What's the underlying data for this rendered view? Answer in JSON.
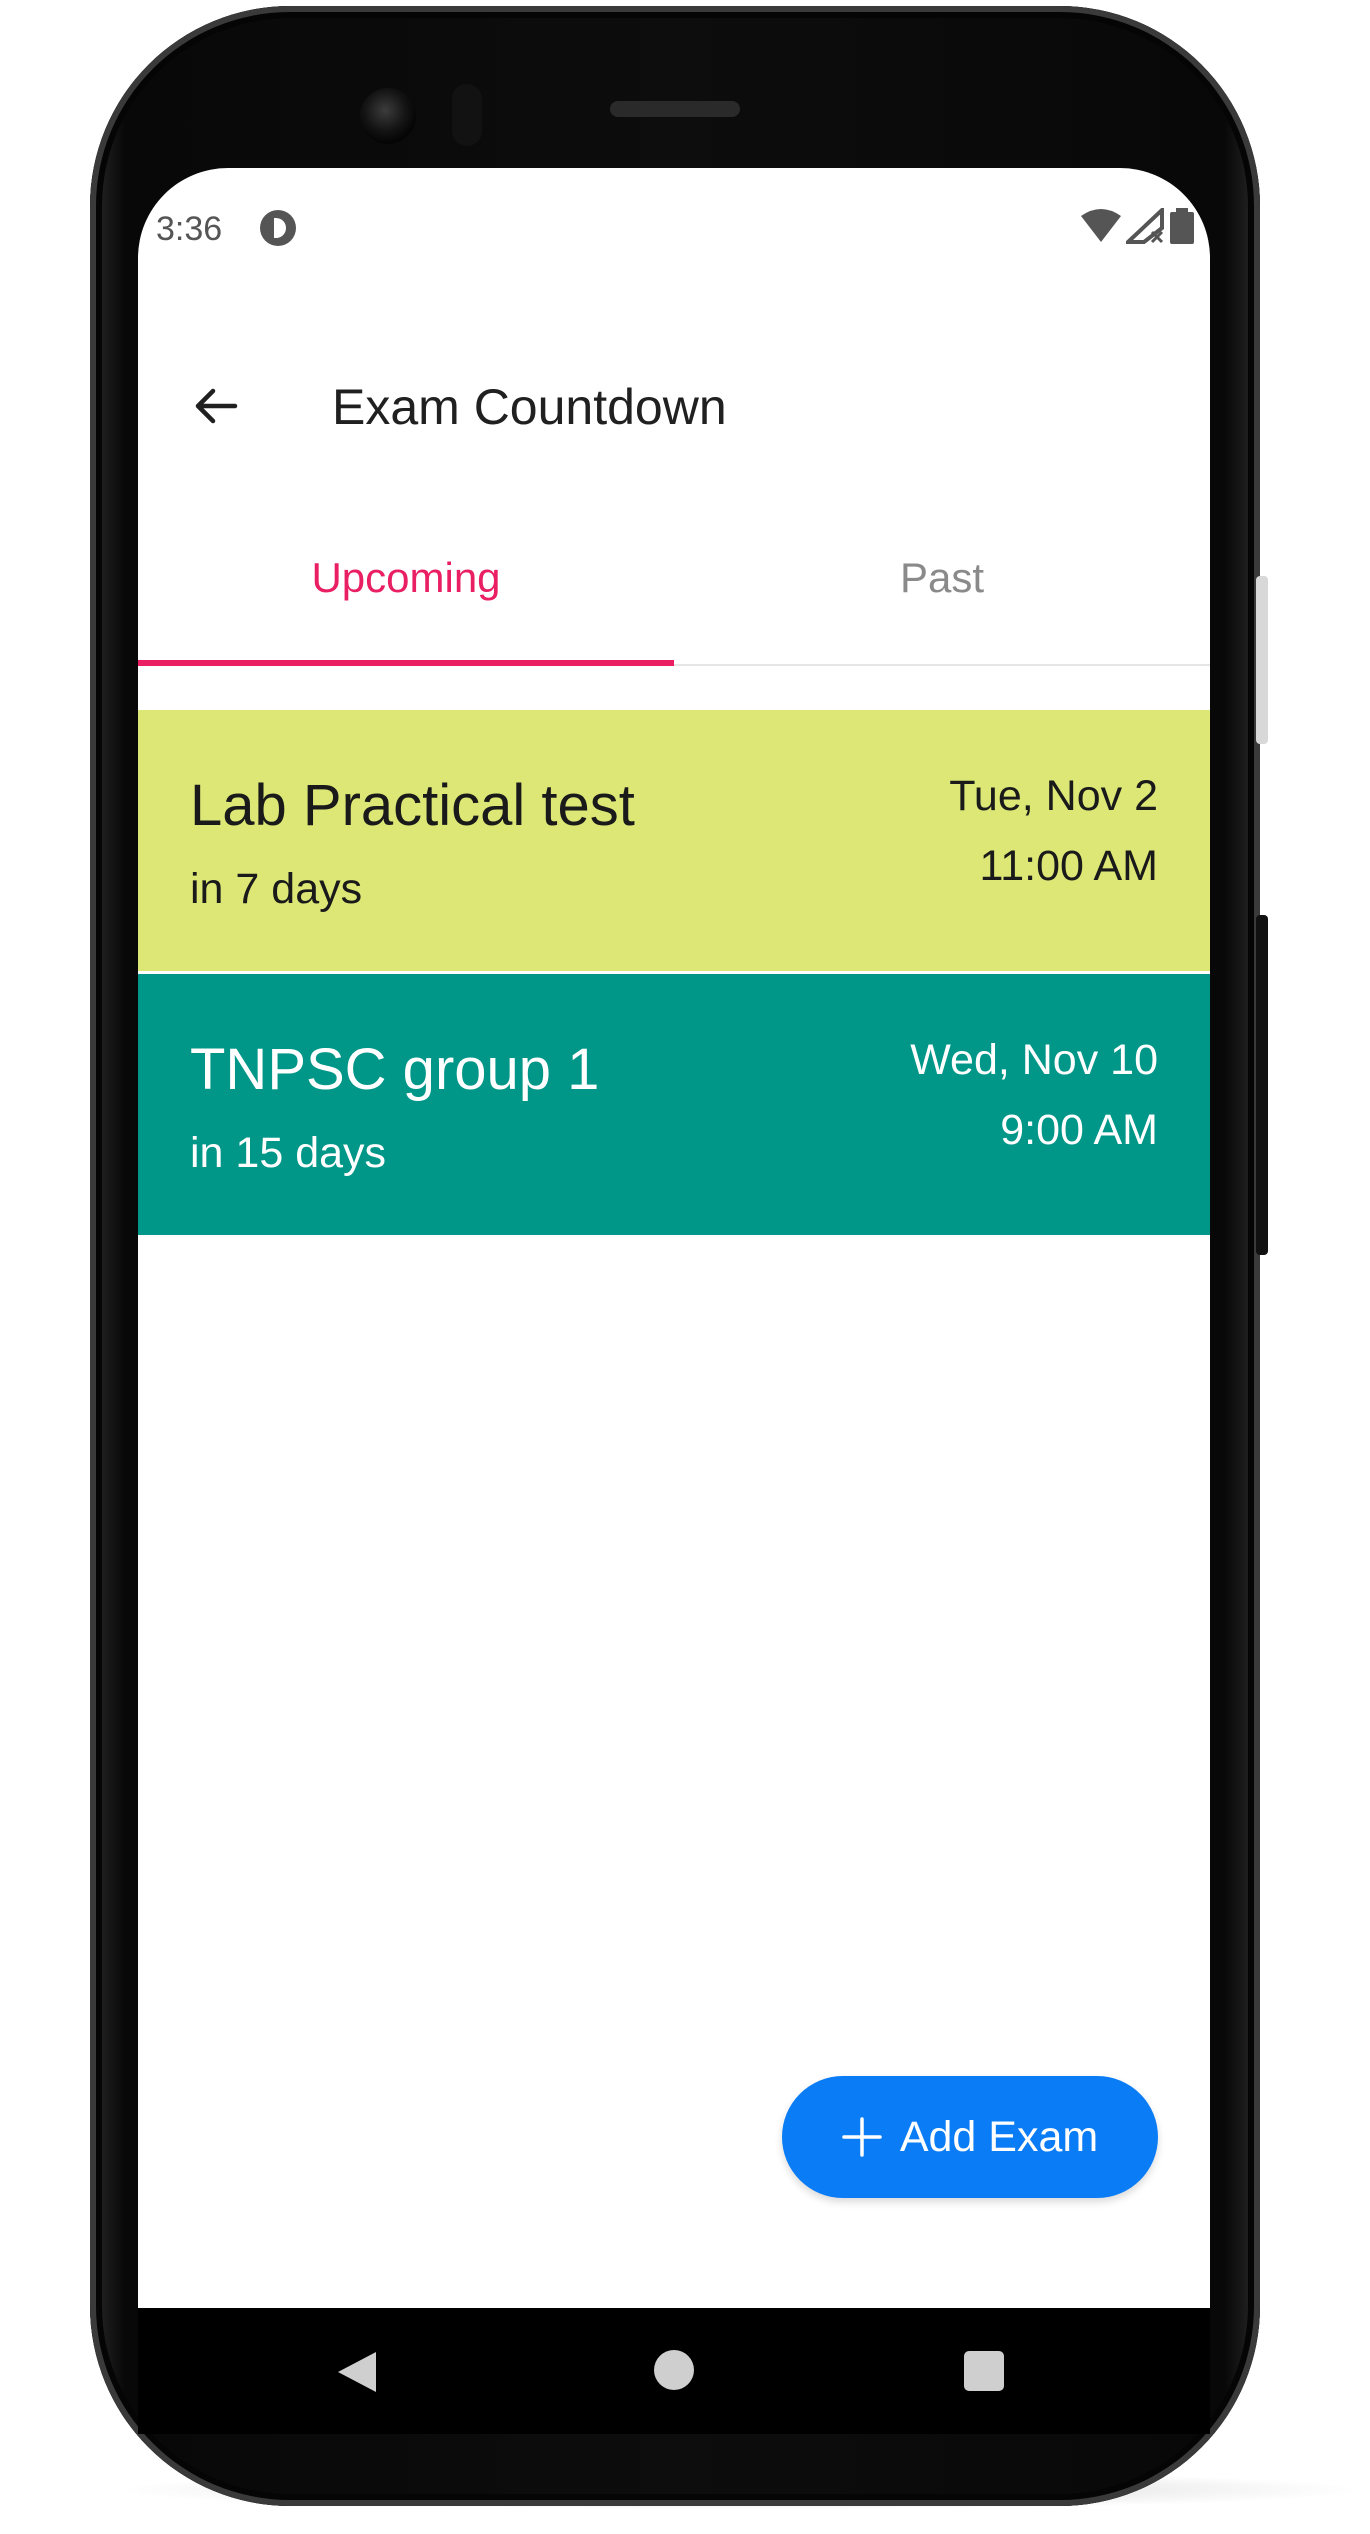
{
  "status_bar": {
    "time": "3:36",
    "app_icon": "app-notification-icon",
    "icons": [
      "wifi-icon",
      "cellular-no-signal-icon",
      "battery-icon"
    ]
  },
  "app_bar": {
    "back_icon": "arrow-back-icon",
    "title": "Exam Countdown"
  },
  "tabs": [
    {
      "label": "Upcoming",
      "selected": true
    },
    {
      "label": "Past",
      "selected": false
    }
  ],
  "colors": {
    "accent": "#e91e63",
    "fab": "#0a7cf5",
    "card_1": "#dce775",
    "card_2": "#009688"
  },
  "exams": [
    {
      "name": "Lab Practical test",
      "countdown": "in 7 days",
      "date": "Tue, Nov 2",
      "time": "11:00 AM",
      "color": "#dce775",
      "text_color": "#1a1a1a"
    },
    {
      "name": "TNPSC group 1",
      "countdown": "in 15 days",
      "date": "Wed, Nov 10",
      "time": "9:00 AM",
      "color": "#009688",
      "text_color": "#ffffff"
    }
  ],
  "fab": {
    "icon": "plus-icon",
    "label": "Add Exam"
  },
  "nav_bar": {
    "icons": [
      "nav-back-icon",
      "nav-home-icon",
      "nav-recents-icon"
    ]
  }
}
